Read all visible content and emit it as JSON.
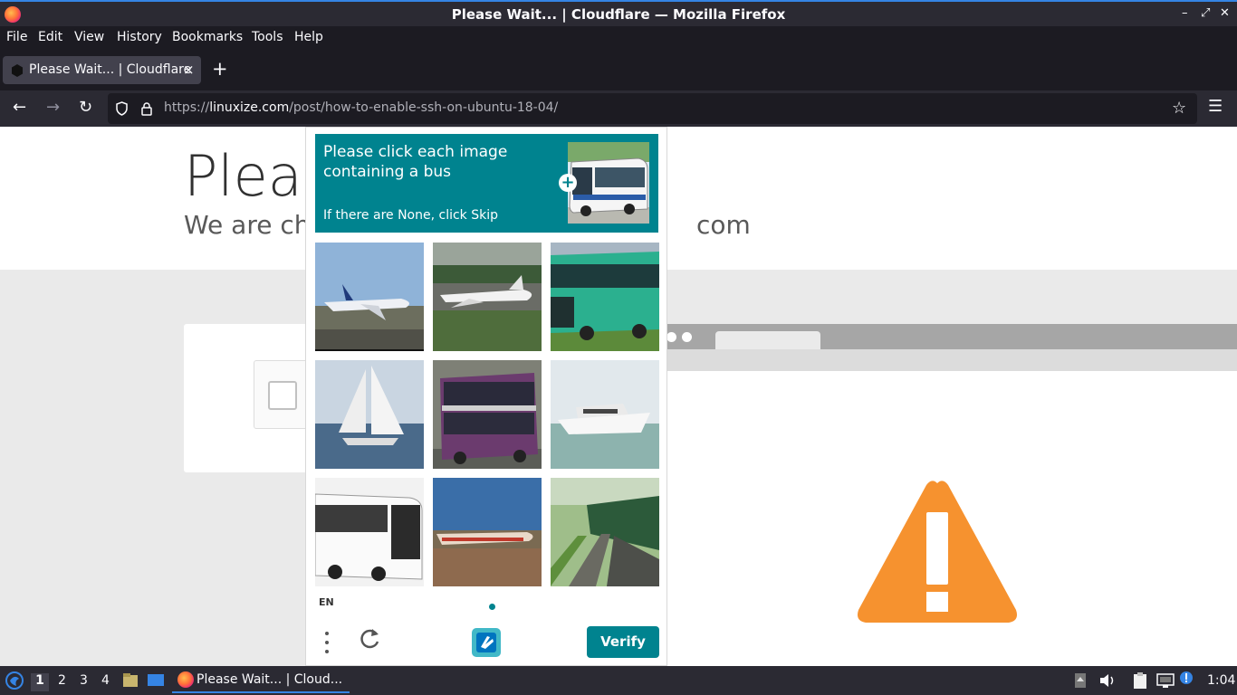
{
  "window": {
    "title": "Please Wait... | Cloudflare — Mozilla Firefox",
    "minimize": "–",
    "restore": "⤢",
    "close": "✕"
  },
  "menubar": {
    "items": [
      "File",
      "Edit",
      "View",
      "History",
      "Bookmarks",
      "Tools",
      "Help"
    ]
  },
  "tab": {
    "title": "Please Wait... | Cloudflare",
    "close": "×",
    "new_tab": "+"
  },
  "navbar": {
    "back": "←",
    "forward": "→",
    "reload": "↻",
    "shield": "⛉",
    "lock": "🔒",
    "url_prefix": "https://",
    "url_domain": "linuxize.com",
    "url_path": "/post/how-to-enable-ssh-on-ubuntu-18-04/",
    "star": "☆",
    "menu": "☰"
  },
  "page": {
    "title": "Pleas",
    "subtitle_left": "We are ch",
    "subtitle_right": "com"
  },
  "captcha": {
    "prompt": "Please click each image containing a bus",
    "prompt_sub": "If there are None, click Skip",
    "plus": "+",
    "tiles": [
      "airplane",
      "airplane",
      "bus",
      "sailboat",
      "double-decker bus",
      "yacht",
      "bus",
      "airplane",
      "train"
    ],
    "language": "EN",
    "menu": "⋮",
    "refresh": "↻",
    "verify_label": "Verify"
  },
  "taskbar": {
    "workspaces": [
      "1",
      "2",
      "3",
      "4"
    ],
    "window_title": "Please Wait... | Cloud...",
    "clock": "1:04"
  },
  "colors": {
    "accent": "#00838f",
    "warning": "#f6922f"
  }
}
